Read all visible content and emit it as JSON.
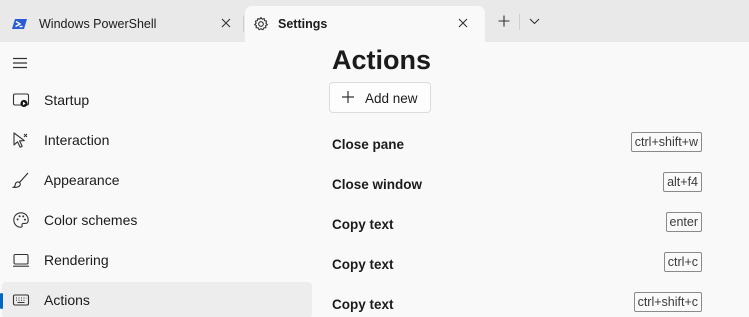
{
  "tabs": [
    {
      "label": "Windows PowerShell",
      "icon": "powershell-icon"
    },
    {
      "label": "Settings",
      "icon": "gear-icon"
    }
  ],
  "nav": {
    "items": [
      {
        "label": "Startup",
        "icon": "startup-icon"
      },
      {
        "label": "Interaction",
        "icon": "interaction-icon"
      },
      {
        "label": "Appearance",
        "icon": "brush-icon"
      },
      {
        "label": "Color schemes",
        "icon": "palette-icon"
      },
      {
        "label": "Rendering",
        "icon": "monitor-icon"
      },
      {
        "label": "Actions",
        "icon": "keyboard-icon",
        "selected": true
      }
    ]
  },
  "main": {
    "title": "Actions",
    "add_button_label": "Add new",
    "actions": [
      {
        "name": "Close pane",
        "keys": "ctrl+shift+w"
      },
      {
        "name": "Close window",
        "keys": "alt+f4"
      },
      {
        "name": "Copy text",
        "keys": "enter"
      },
      {
        "name": "Copy text",
        "keys": "ctrl+c"
      },
      {
        "name": "Copy text",
        "keys": "ctrl+shift+c"
      }
    ]
  },
  "colors": {
    "accent": "#0067c0",
    "powershell_icon": "#2a5bd7"
  }
}
